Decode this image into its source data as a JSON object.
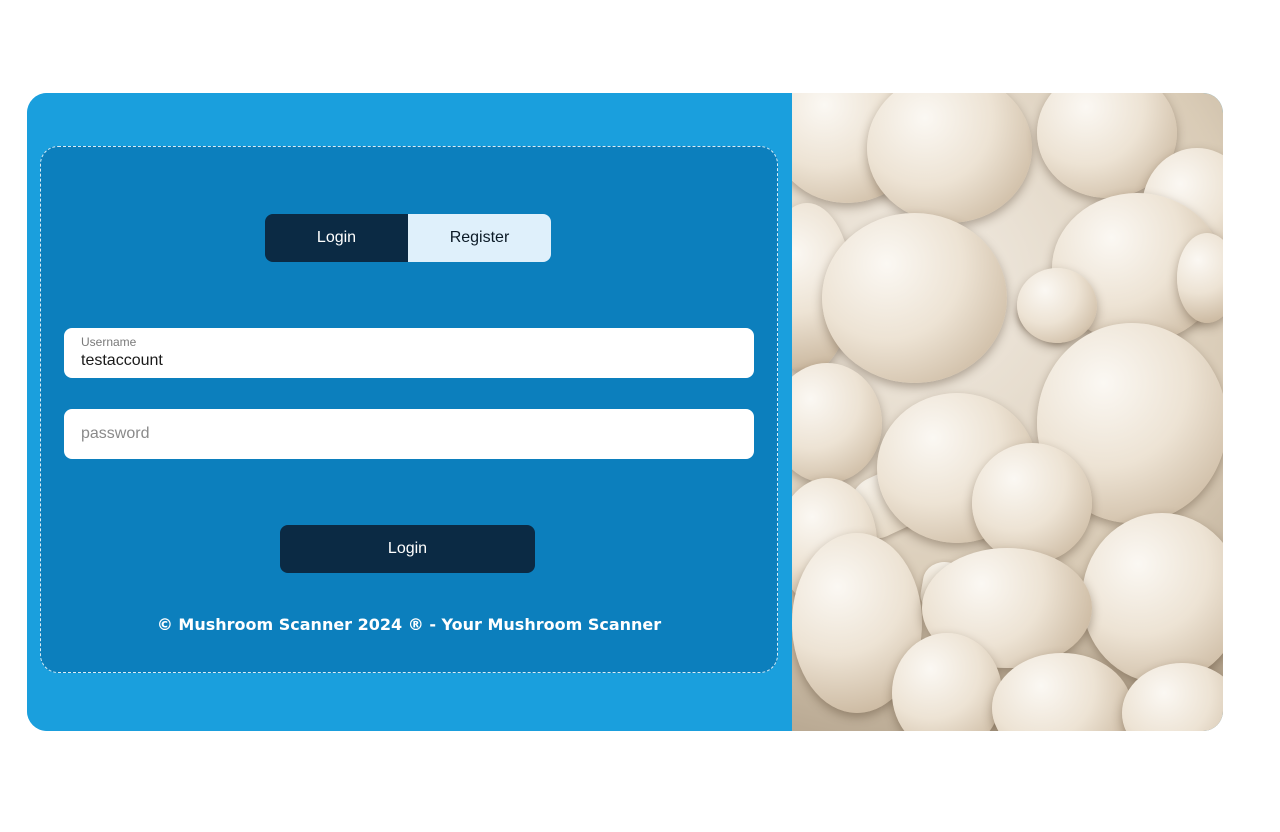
{
  "tabs": {
    "login_label": "Login",
    "register_label": "Register",
    "active": "login"
  },
  "form": {
    "username": {
      "label": "Username",
      "value": "testaccount"
    },
    "password": {
      "placeholder": "password",
      "value": ""
    },
    "submit_label": "Login"
  },
  "footer": {
    "text": "© Mushroom Scanner 2024 ® - Your Mushroom Scanner"
  },
  "image": {
    "subject": "white button mushrooms"
  },
  "colors": {
    "outer_panel": "#1a9fdd",
    "inner_panel": "#0c7fbd",
    "dark_button": "#0b2a44",
    "light_tab": "#dff0fb"
  }
}
